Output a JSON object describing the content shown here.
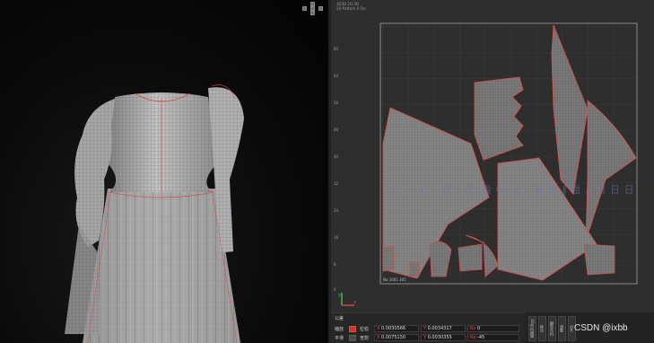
{
  "viewport2d": {
    "info_line1": "3D3D 2D 3D",
    "info_line2": "2D Pattern 0.5m",
    "ruler_numbers": [
      "80",
      "64",
      "56",
      "48",
      "40",
      "32",
      "24",
      "16",
      "8",
      "0"
    ],
    "board_label": "No 1001 305",
    "overlay_text": "学尔 · 了 ∷ 在 ∥ 你, 看 中, 我 · 看 关 ∥ 看 ∧ 日 日 日",
    "axis_x": "x",
    "axis_y": "y"
  },
  "prop_panel": {
    "title": "公差",
    "row1": {
      "label": "缩放",
      "sub1": "粒稳",
      "x_axis": "X",
      "x_value": "0.0030566",
      "y_axis": "Y",
      "y_value": "0.0034317",
      "r_axis": "Rx",
      "r_value": "0"
    },
    "row2": {
      "label": "平滑",
      "sub1": "宽数",
      "x_axis": "X",
      "x_value": "0.0075150",
      "y_axis": "Y",
      "y_value": "0.0030355",
      "r_axis": "Rx",
      "r_value": "-45"
    }
  },
  "side_panel": {
    "buttons": [
      "3D布料编辑",
      "移动",
      "翻转布料",
      "调整",
      "对齐",
      "显示"
    ]
  },
  "watermark": "CSDN @ixbb",
  "colors": {
    "seam_red": "#d05050",
    "mesh_line": "#8a8a8a",
    "cloth_fill": "#a9a9a9",
    "panel_bg": "#2e2e2e"
  }
}
